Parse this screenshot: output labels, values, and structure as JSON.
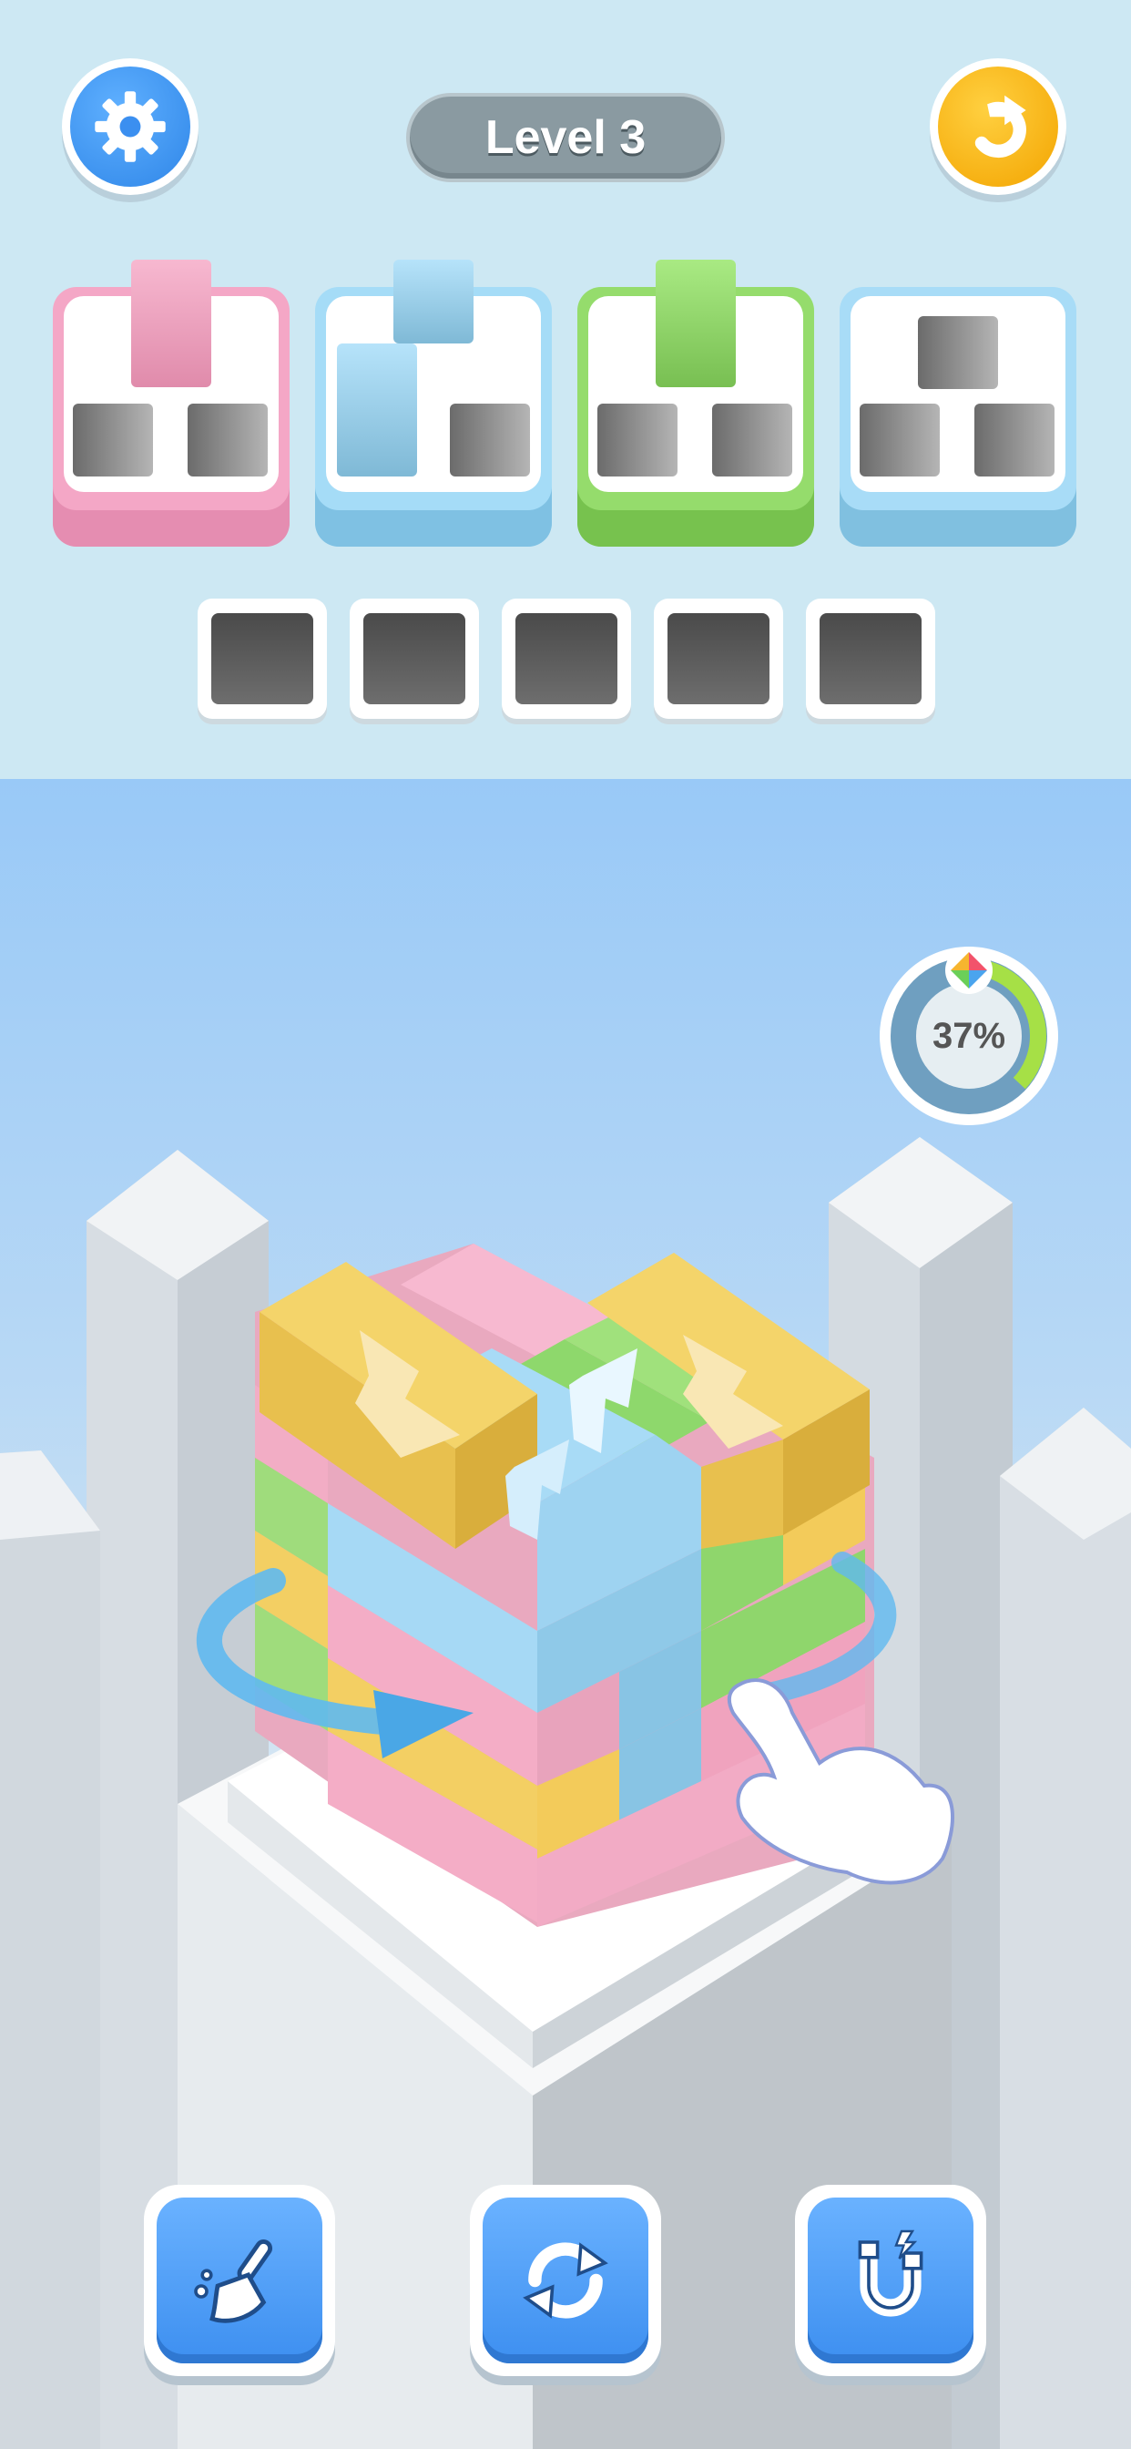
{
  "header": {
    "level_label": "Level 3",
    "settings_icon": "gear-icon",
    "undo_icon": "undo-arrow-icon"
  },
  "goals": [
    {
      "color": "pink",
      "accent": "#f7a9c9",
      "piece": "#f4b6cf"
    },
    {
      "color": "blue",
      "accent": "#9fdcff",
      "piece": "#a8dcf7"
    },
    {
      "color": "green",
      "accent": "#90d96a",
      "piece": "#9fe27b"
    },
    {
      "color": "blue",
      "accent": "#a8dcf7",
      "piece": ""
    }
  ],
  "tray": {
    "slots": 5
  },
  "progress": {
    "percent": 37,
    "label": "37%"
  },
  "tools": [
    {
      "name": "broom-icon"
    },
    {
      "name": "shuffle-icon"
    },
    {
      "name": "magnet-icon"
    }
  ],
  "colors": {
    "pink": "#f4a9c4",
    "blue": "#9fd6f4",
    "green": "#9be07a",
    "yellow": "#f5d163"
  }
}
